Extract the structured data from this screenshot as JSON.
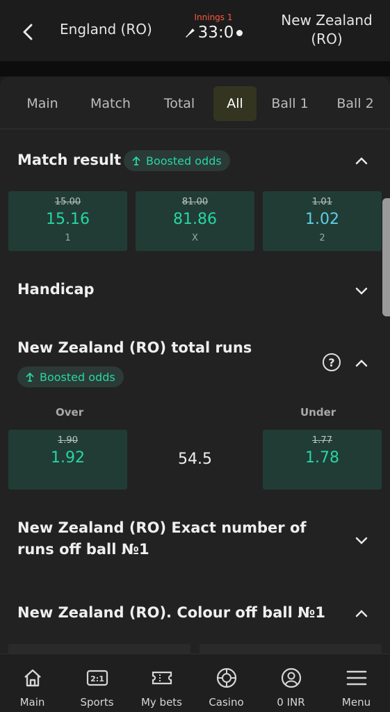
{
  "header": {
    "team1": "England (RO)",
    "innings": "Innings 1",
    "score": "33:0",
    "team2": "New Zealand (RO)"
  },
  "tabs": [
    {
      "label": "Main"
    },
    {
      "label": "Match"
    },
    {
      "label": "Total"
    },
    {
      "label": "All",
      "active": true
    },
    {
      "label": "Ball 1"
    },
    {
      "label": "Ball 2"
    }
  ],
  "match_result": {
    "title": "Match result",
    "badge": "Boosted odds",
    "odds": [
      {
        "old": "15.00",
        "new": "15.16",
        "label": "1"
      },
      {
        "old": "81.00",
        "new": "81.86",
        "label": "X"
      },
      {
        "old": "1.01",
        "new": "1.02",
        "label": "2"
      }
    ]
  },
  "handicap": {
    "title": "Handicap"
  },
  "total_runs": {
    "title": "New Zealand (RO) total runs",
    "badge": "Boosted odds",
    "over_label": "Over",
    "under_label": "Under",
    "line": "54.5",
    "over": {
      "old": "1.90",
      "new": "1.92"
    },
    "under": {
      "old": "1.77",
      "new": "1.78"
    }
  },
  "exact_runs": {
    "title": "New Zealand (RO) Exact number of runs off ball №1"
  },
  "colour": {
    "title": "New Zealand (RO). Colour off ball №1"
  },
  "nav": [
    {
      "label": "Main",
      "icon": "home-icon"
    },
    {
      "label": "Sports",
      "icon": "sports-icon"
    },
    {
      "label": "My bets",
      "icon": "ticket-icon"
    },
    {
      "label": "Casino",
      "icon": "casino-chip-icon"
    },
    {
      "label": "0 INR",
      "icon": "account-icon"
    },
    {
      "label": "Menu",
      "icon": "menu-icon"
    }
  ],
  "colors": {
    "accent_green": "#27d6a0",
    "accent_blue": "#5ccfe6",
    "innings_red": "#ff5a3c",
    "odd_bg": "#213c35"
  }
}
